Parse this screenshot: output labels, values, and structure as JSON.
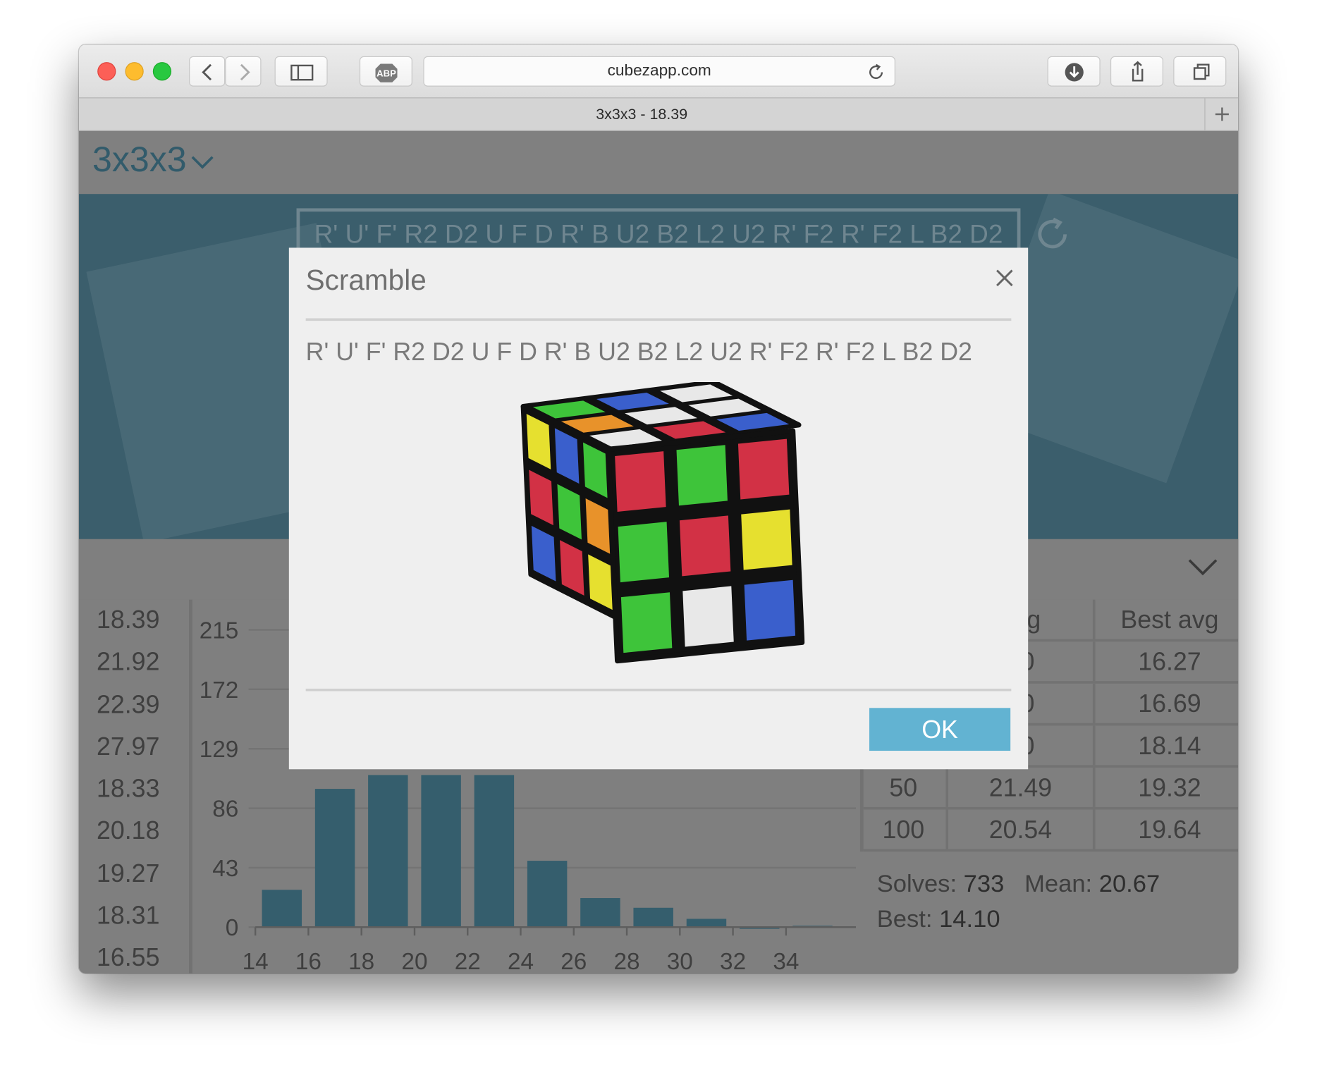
{
  "browser": {
    "url": "cubezapp.com",
    "tab_title": "3x3x3 - 18.39",
    "controls": [
      "back-icon",
      "forward-icon",
      "sidebar-icon",
      "abp-icon",
      "reload-icon",
      "download-icon",
      "share-icon",
      "tabs-icon",
      "new-tab-icon"
    ]
  },
  "app": {
    "puzzle_name": "3x3x3",
    "scramble": "R' U' F' R2 D2 U F D R' B U2 B2 L2 U2 R' F2 R' F2 L B2 D2",
    "recent_times": [
      "18.39",
      "21.92",
      "22.39",
      "27.97",
      "18.33",
      "20.18",
      "19.27",
      "18.31",
      "16.55"
    ],
    "averages_table": {
      "headers": [
        "",
        "avg",
        "Best avg"
      ],
      "rows": [
        [
          "",
          "90",
          "16.27"
        ],
        [
          "",
          "90",
          "16.69"
        ],
        [
          "",
          "70",
          "18.14"
        ],
        [
          "50",
          "21.49",
          "19.32"
        ],
        [
          "100",
          "20.54",
          "19.64"
        ]
      ]
    },
    "summary": {
      "solves_label": "Solves:",
      "solves": "733",
      "mean_label": "Mean:",
      "mean": "20.67",
      "best_label": "Best:",
      "best": "14.10"
    }
  },
  "chart_data": {
    "type": "bar",
    "x": [
      15,
      17,
      19,
      21,
      23,
      25,
      27,
      29,
      31,
      33,
      35
    ],
    "values": [
      27,
      100,
      110,
      110,
      110,
      48,
      21,
      14,
      6,
      0,
      1
    ],
    "xticks": [
      14,
      16,
      18,
      20,
      22,
      24,
      26,
      28,
      30,
      32,
      34
    ],
    "yticks": [
      0,
      43,
      86,
      129,
      172,
      215
    ],
    "ylim": [
      0,
      215
    ],
    "xlim": [
      14,
      36
    ],
    "bar_color": "#355e6d"
  },
  "modal": {
    "title": "Scramble",
    "scramble": "R' U' F' R2 D2 U F D R' B U2 B2 L2 U2 R' F2 R' F2 L B2 D2",
    "ok_label": "OK",
    "cube_state": {
      "top": [
        [
          "green",
          "blue",
          "white"
        ],
        [
          "orange",
          "white",
          "white"
        ],
        [
          "white",
          "red",
          "blue"
        ]
      ],
      "front": [
        [
          "red",
          "green",
          "red"
        ],
        [
          "green",
          "red",
          "yellow"
        ],
        [
          "green",
          "white",
          "blue"
        ]
      ],
      "left": [
        [
          "yellow",
          "blue",
          "green"
        ],
        [
          "red",
          "green",
          "orange"
        ],
        [
          "blue",
          "red",
          "yellow"
        ]
      ]
    },
    "colors": {
      "white": "#e8e8e8",
      "yellow": "#e6e02f",
      "red": "#d23145",
      "orange": "#e8922a",
      "blue": "#3a5fcc",
      "green": "#3ec43a"
    }
  },
  "theme": {
    "accent": "#62b3d2",
    "dark_teal": "#3b5e6c"
  }
}
